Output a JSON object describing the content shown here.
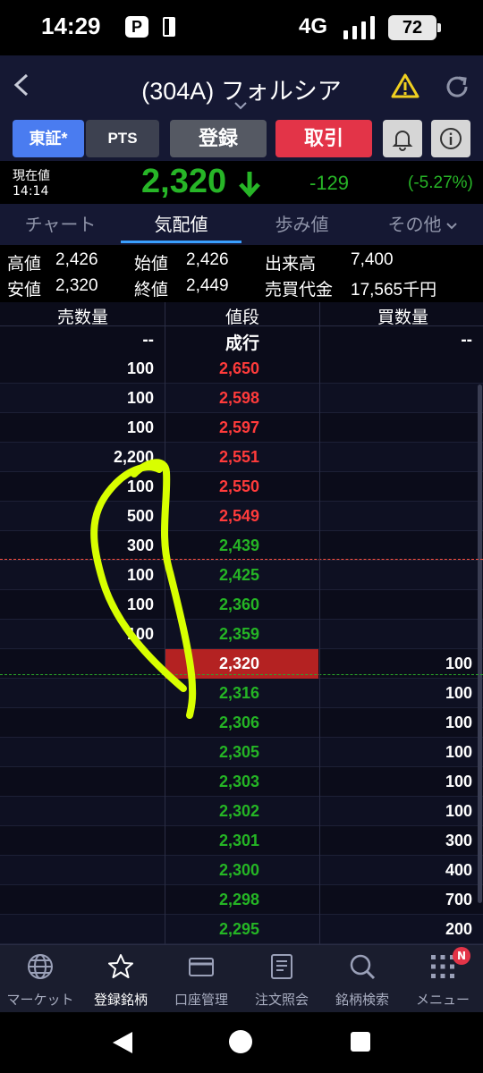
{
  "status_bar": {
    "time": "14:29",
    "pay_icon_letter": "P",
    "network": "4G",
    "battery": "72"
  },
  "header": {
    "title": "(304A) フォルシア"
  },
  "toolbar": {
    "market_tosho": "東証*",
    "market_pts": "PTS",
    "register": "登録",
    "trade": "取引"
  },
  "price": {
    "label": "現在値",
    "time": "14:14",
    "value": "2,320",
    "change": "-129",
    "change_pct": "(-5.27%)",
    "color_down": "#27b527"
  },
  "tabs": [
    {
      "label": "チャート",
      "active": false
    },
    {
      "label": "気配値",
      "active": true
    },
    {
      "label": "歩み値",
      "active": false
    },
    {
      "label": "その他",
      "active": false
    }
  ],
  "stats": {
    "high_label": "高値",
    "high": "2,426",
    "open_label": "始値",
    "open": "2,426",
    "volume_label": "出来高",
    "volume": "7,400",
    "low_label": "安値",
    "low": "2,320",
    "close_label": "終値",
    "close": "2,449",
    "turnover_label": "売買代金",
    "turnover": "17,565千円"
  },
  "book": {
    "headers": {
      "ask": "売数量",
      "price": "値段",
      "bid": "買数量"
    },
    "market_order": {
      "ask": "--",
      "price": "成行",
      "bid": "--"
    },
    "rows": [
      {
        "ask": "100",
        "price": "2,650",
        "bid": "",
        "color": "red"
      },
      {
        "ask": "100",
        "price": "2,598",
        "bid": "",
        "color": "red"
      },
      {
        "ask": "100",
        "price": "2,597",
        "bid": "",
        "color": "red"
      },
      {
        "ask": "2,200",
        "price": "2,551",
        "bid": "",
        "color": "red"
      },
      {
        "ask": "100",
        "price": "2,550",
        "bid": "",
        "color": "red"
      },
      {
        "ask": "500",
        "price": "2,549",
        "bid": "",
        "color": "red"
      },
      {
        "ask": "300",
        "price": "2,439",
        "bid": "",
        "color": "green"
      },
      {
        "ask": "100",
        "price": "2,425",
        "bid": "",
        "color": "green"
      },
      {
        "ask": "100",
        "price": "2,360",
        "bid": "",
        "color": "green"
      },
      {
        "ask": "100",
        "price": "2,359",
        "bid": "",
        "color": "green"
      },
      {
        "ask": "",
        "price": "2,320",
        "bid": "100",
        "color": "current"
      },
      {
        "ask": "",
        "price": "2,316",
        "bid": "100",
        "color": "green"
      },
      {
        "ask": "",
        "price": "2,306",
        "bid": "100",
        "color": "green"
      },
      {
        "ask": "",
        "price": "2,305",
        "bid": "100",
        "color": "green"
      },
      {
        "ask": "",
        "price": "2,303",
        "bid": "100",
        "color": "green"
      },
      {
        "ask": "",
        "price": "2,302",
        "bid": "100",
        "color": "green"
      },
      {
        "ask": "",
        "price": "2,301",
        "bid": "300",
        "color": "green"
      },
      {
        "ask": "",
        "price": "2,300",
        "bid": "400",
        "color": "green"
      },
      {
        "ask": "",
        "price": "2,298",
        "bid": "700",
        "color": "green"
      },
      {
        "ask": "",
        "price": "2,295",
        "bid": "200",
        "color": "green"
      }
    ]
  },
  "bottom_nav": [
    {
      "label": "マーケット",
      "icon": "globe-icon",
      "active": false
    },
    {
      "label": "登録銘柄",
      "icon": "star-icon",
      "active": true
    },
    {
      "label": "口座管理",
      "icon": "card-icon",
      "active": false
    },
    {
      "label": "注文照会",
      "icon": "document-icon",
      "active": false
    },
    {
      "label": "銘柄検索",
      "icon": "search-icon",
      "active": false
    },
    {
      "label": "メニュー",
      "icon": "grid-icon",
      "active": false,
      "badge": "N"
    }
  ],
  "colors": {
    "ask_up": "#ff3b3b",
    "down": "#25b525",
    "current_bg": "#b42222",
    "accent": "#3aa0ff",
    "trade": "#e33448",
    "highlighter": "#d8ff00"
  }
}
